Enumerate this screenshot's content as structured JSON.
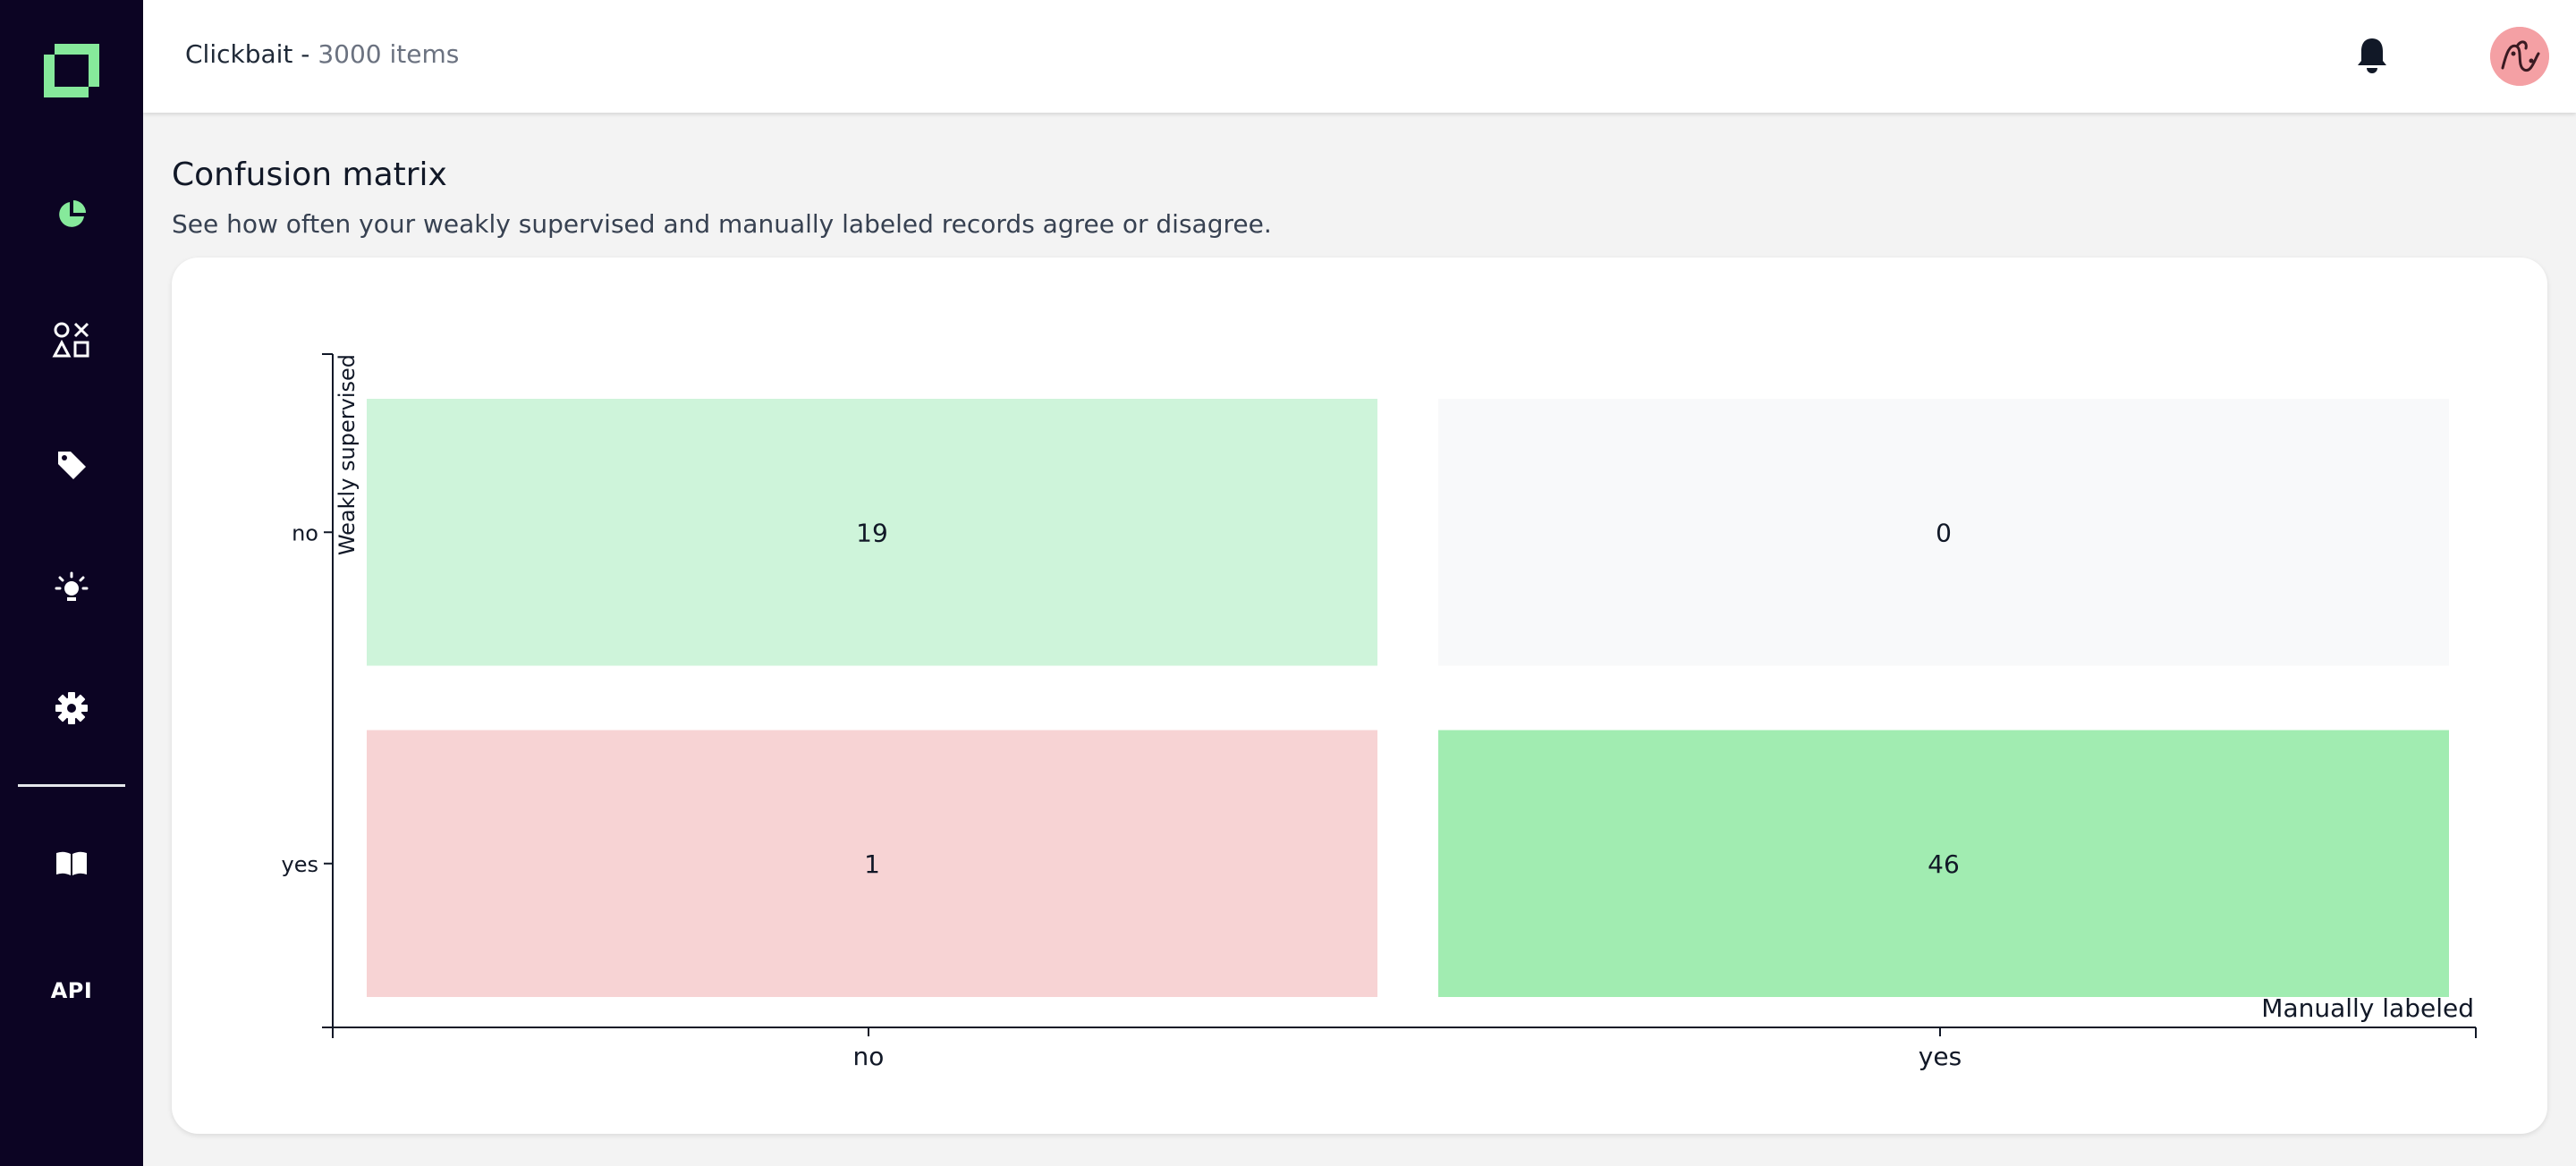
{
  "project": {
    "name": "Clickbait - ",
    "count_label": "3000 items"
  },
  "sidebar": {
    "logo": "kern-logo-icon",
    "items": [
      {
        "icon": "overview-pie-icon"
      },
      {
        "icon": "shapes-icon"
      },
      {
        "icon": "label-tag-icon"
      },
      {
        "icon": "lightbulb-icon"
      },
      {
        "icon": "gear-icon"
      },
      {
        "icon": "book-icon"
      },
      {
        "icon": "api-icon",
        "label": "API"
      }
    ]
  },
  "header": {
    "bell_icon": "bell-icon",
    "avatar_icon": "user-avatar-icon"
  },
  "page": {
    "title": "Confusion matrix",
    "subtitle": "See how often your weakly supervised and manually labeled records agree or disagree."
  },
  "colors": {
    "sidebar": "#0c0423",
    "accent": "#86e99b",
    "agree_high": "#a1ecb1",
    "agree_low": "#cef4da",
    "disagree": "#f7d3d4",
    "empty": "#f8f9fa"
  },
  "chart_data": {
    "type": "heatmap",
    "title": "",
    "xlabel": "Manually labeled",
    "ylabel": "Weakly supervised",
    "x_categories": [
      "no",
      "yes"
    ],
    "y_categories": [
      "no",
      "yes"
    ],
    "cells": [
      {
        "x": "no",
        "y": "no",
        "value": 19
      },
      {
        "x": "yes",
        "y": "no",
        "value": 0
      },
      {
        "x": "no",
        "y": "yes",
        "value": 1
      },
      {
        "x": "yes",
        "y": "yes",
        "value": 46
      }
    ]
  }
}
